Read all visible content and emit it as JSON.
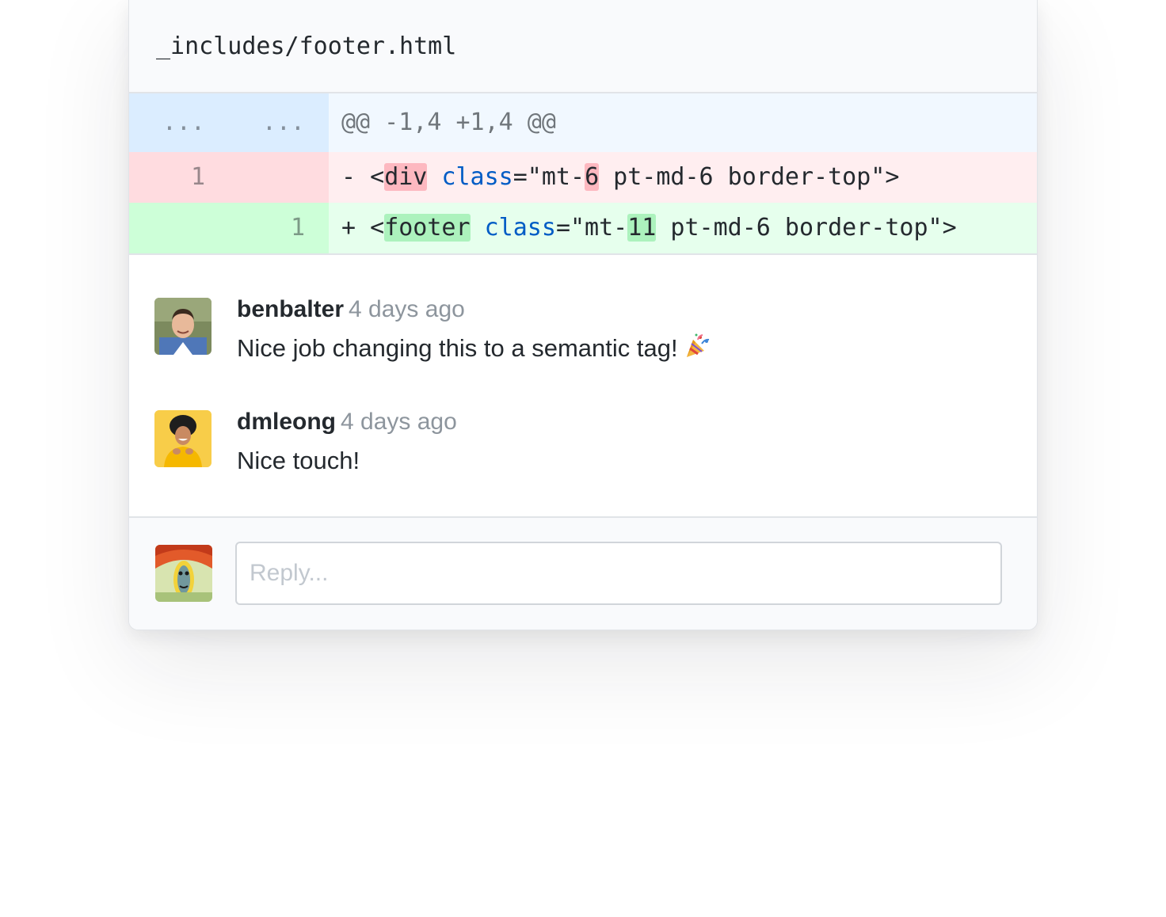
{
  "file": {
    "path": "_includes/footer.html"
  },
  "diff": {
    "hunk": {
      "left_num": "...",
      "right_num": "...",
      "text": "@@ -1,4 +1,4 @@"
    },
    "deletion": {
      "left_num": "1",
      "right_num": "",
      "sign": "- ",
      "lt": "<",
      "tag": "div",
      "space": " ",
      "attr": "class",
      "eq_open": "=\"mt-",
      "changed": "6",
      "rest": " pt-md-6 border-top\">"
    },
    "addition": {
      "left_num": "",
      "right_num": "1",
      "sign": "+ ",
      "lt": "<",
      "tag": "footer",
      "space": " ",
      "attr": "class",
      "eq_open": "=\"mt-",
      "changed": "11",
      "rest": " pt-md-6 border-top\">"
    }
  },
  "comments": [
    {
      "author": "benbalter",
      "time": "4 days ago",
      "body": "Nice job changing this to a semantic tag!",
      "emoji": "party-popper-icon"
    },
    {
      "author": "dmleong",
      "time": "4 days ago",
      "body": "Nice touch!"
    }
  ],
  "reply": {
    "placeholder": "Reply..."
  },
  "colors": {
    "deletion_bg": "#ffeef0",
    "addition_bg": "#e6ffed",
    "hunk_bg": "#f1f8ff",
    "keyword": "#005cc5"
  }
}
